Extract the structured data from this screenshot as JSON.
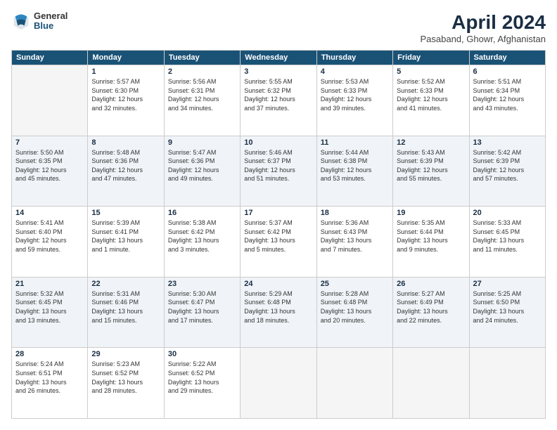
{
  "header": {
    "logo": {
      "general": "General",
      "blue": "Blue"
    },
    "title": "April 2024",
    "location": "Pasaband, Ghowr, Afghanistan"
  },
  "days_of_week": [
    "Sunday",
    "Monday",
    "Tuesday",
    "Wednesday",
    "Thursday",
    "Friday",
    "Saturday"
  ],
  "weeks": [
    [
      {
        "day": "",
        "info": ""
      },
      {
        "day": "1",
        "info": "Sunrise: 5:57 AM\nSunset: 6:30 PM\nDaylight: 12 hours\nand 32 minutes."
      },
      {
        "day": "2",
        "info": "Sunrise: 5:56 AM\nSunset: 6:31 PM\nDaylight: 12 hours\nand 34 minutes."
      },
      {
        "day": "3",
        "info": "Sunrise: 5:55 AM\nSunset: 6:32 PM\nDaylight: 12 hours\nand 37 minutes."
      },
      {
        "day": "4",
        "info": "Sunrise: 5:53 AM\nSunset: 6:33 PM\nDaylight: 12 hours\nand 39 minutes."
      },
      {
        "day": "5",
        "info": "Sunrise: 5:52 AM\nSunset: 6:33 PM\nDaylight: 12 hours\nand 41 minutes."
      },
      {
        "day": "6",
        "info": "Sunrise: 5:51 AM\nSunset: 6:34 PM\nDaylight: 12 hours\nand 43 minutes."
      }
    ],
    [
      {
        "day": "7",
        "info": "Sunrise: 5:50 AM\nSunset: 6:35 PM\nDaylight: 12 hours\nand 45 minutes."
      },
      {
        "day": "8",
        "info": "Sunrise: 5:48 AM\nSunset: 6:36 PM\nDaylight: 12 hours\nand 47 minutes."
      },
      {
        "day": "9",
        "info": "Sunrise: 5:47 AM\nSunset: 6:36 PM\nDaylight: 12 hours\nand 49 minutes."
      },
      {
        "day": "10",
        "info": "Sunrise: 5:46 AM\nSunset: 6:37 PM\nDaylight: 12 hours\nand 51 minutes."
      },
      {
        "day": "11",
        "info": "Sunrise: 5:44 AM\nSunset: 6:38 PM\nDaylight: 12 hours\nand 53 minutes."
      },
      {
        "day": "12",
        "info": "Sunrise: 5:43 AM\nSunset: 6:39 PM\nDaylight: 12 hours\nand 55 minutes."
      },
      {
        "day": "13",
        "info": "Sunrise: 5:42 AM\nSunset: 6:39 PM\nDaylight: 12 hours\nand 57 minutes."
      }
    ],
    [
      {
        "day": "14",
        "info": "Sunrise: 5:41 AM\nSunset: 6:40 PM\nDaylight: 12 hours\nand 59 minutes."
      },
      {
        "day": "15",
        "info": "Sunrise: 5:39 AM\nSunset: 6:41 PM\nDaylight: 13 hours\nand 1 minute."
      },
      {
        "day": "16",
        "info": "Sunrise: 5:38 AM\nSunset: 6:42 PM\nDaylight: 13 hours\nand 3 minutes."
      },
      {
        "day": "17",
        "info": "Sunrise: 5:37 AM\nSunset: 6:42 PM\nDaylight: 13 hours\nand 5 minutes."
      },
      {
        "day": "18",
        "info": "Sunrise: 5:36 AM\nSunset: 6:43 PM\nDaylight: 13 hours\nand 7 minutes."
      },
      {
        "day": "19",
        "info": "Sunrise: 5:35 AM\nSunset: 6:44 PM\nDaylight: 13 hours\nand 9 minutes."
      },
      {
        "day": "20",
        "info": "Sunrise: 5:33 AM\nSunset: 6:45 PM\nDaylight: 13 hours\nand 11 minutes."
      }
    ],
    [
      {
        "day": "21",
        "info": "Sunrise: 5:32 AM\nSunset: 6:45 PM\nDaylight: 13 hours\nand 13 minutes."
      },
      {
        "day": "22",
        "info": "Sunrise: 5:31 AM\nSunset: 6:46 PM\nDaylight: 13 hours\nand 15 minutes."
      },
      {
        "day": "23",
        "info": "Sunrise: 5:30 AM\nSunset: 6:47 PM\nDaylight: 13 hours\nand 17 minutes."
      },
      {
        "day": "24",
        "info": "Sunrise: 5:29 AM\nSunset: 6:48 PM\nDaylight: 13 hours\nand 18 minutes."
      },
      {
        "day": "25",
        "info": "Sunrise: 5:28 AM\nSunset: 6:48 PM\nDaylight: 13 hours\nand 20 minutes."
      },
      {
        "day": "26",
        "info": "Sunrise: 5:27 AM\nSunset: 6:49 PM\nDaylight: 13 hours\nand 22 minutes."
      },
      {
        "day": "27",
        "info": "Sunrise: 5:25 AM\nSunset: 6:50 PM\nDaylight: 13 hours\nand 24 minutes."
      }
    ],
    [
      {
        "day": "28",
        "info": "Sunrise: 5:24 AM\nSunset: 6:51 PM\nDaylight: 13 hours\nand 26 minutes."
      },
      {
        "day": "29",
        "info": "Sunrise: 5:23 AM\nSunset: 6:52 PM\nDaylight: 13 hours\nand 28 minutes."
      },
      {
        "day": "30",
        "info": "Sunrise: 5:22 AM\nSunset: 6:52 PM\nDaylight: 13 hours\nand 29 minutes."
      },
      {
        "day": "",
        "info": ""
      },
      {
        "day": "",
        "info": ""
      },
      {
        "day": "",
        "info": ""
      },
      {
        "day": "",
        "info": ""
      }
    ]
  ]
}
